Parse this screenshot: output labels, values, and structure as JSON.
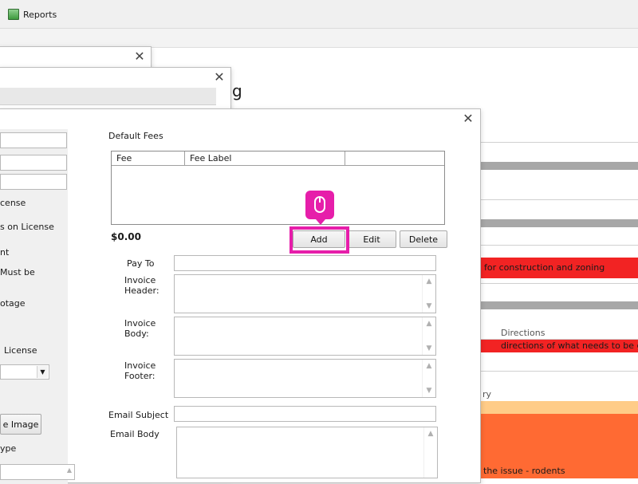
{
  "app": {
    "menu_reports": "Reports"
  },
  "background": {
    "heading_fragment": "g",
    "red_row_1": "for construction and zoning",
    "column_directions": "Directions",
    "red_row_2": "directions of what needs to be gath",
    "column_ry": "ry",
    "orange_row_last": "the issue - rodents"
  },
  "left_panel": {
    "label_license": "cense",
    "label_on_license": "s on License",
    "label_nt": "nt",
    "label_must_be": "Must be",
    "label_otage": "otage",
    "label_license2": "License",
    "image_button": "e Image",
    "label_ype": "ype"
  },
  "fees": {
    "section_title": "Default Fees",
    "columns": [
      "Fee",
      "Fee Label",
      ""
    ],
    "total": "$0.00",
    "add_label": "Add",
    "edit_label": "Edit",
    "delete_label": "Delete"
  },
  "invoice": {
    "pay_to_label": "Pay To",
    "pay_to_value": "",
    "header_label_1": "Invoice",
    "header_label_2": "Header:",
    "body_label_1": "Invoice",
    "body_label_2": "Body:",
    "footer_label_1": "Invoice",
    "footer_label_2": "Footer:"
  },
  "email": {
    "subject_label": "Email Subject",
    "subject_value": "",
    "body_label": "Email Body"
  },
  "colors": {
    "highlight": "#e61eaa",
    "red_row": "#f22323",
    "orange_row": "#ff6a33",
    "light_orange_row": "#ffcc88"
  }
}
